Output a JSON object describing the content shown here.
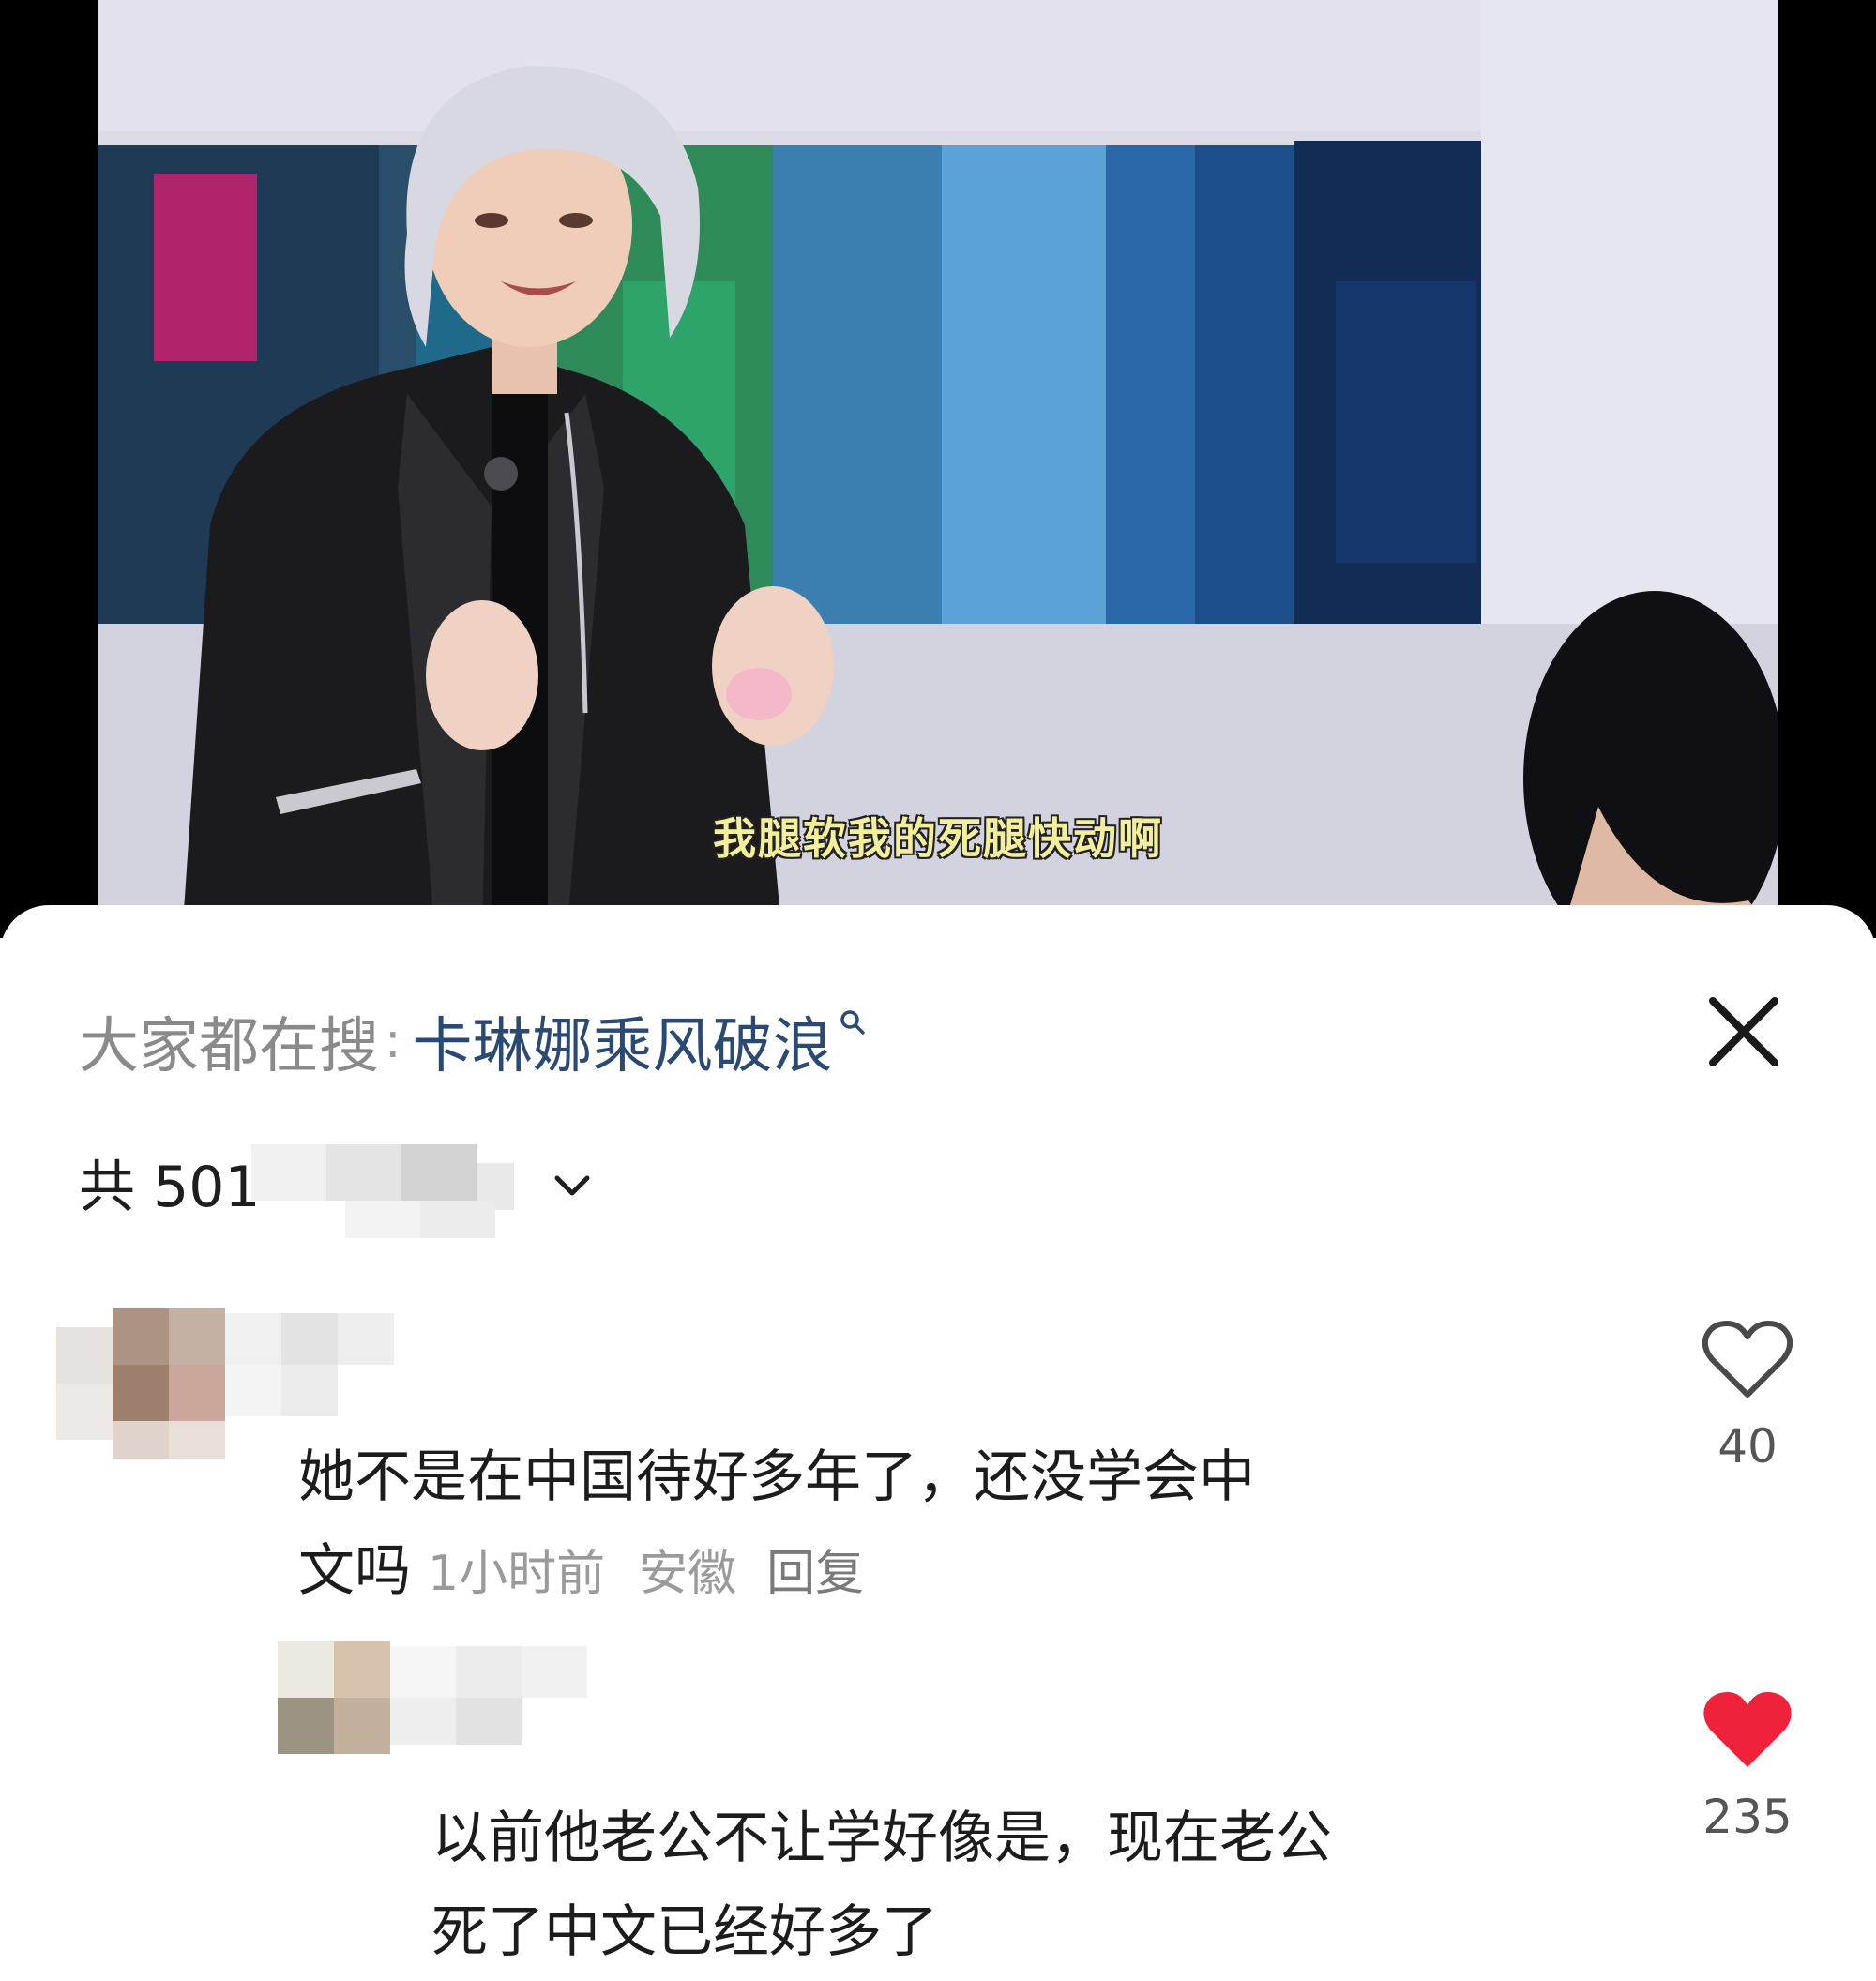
{
  "video": {
    "subtitle": "我腿软我的死腿快动啊"
  },
  "search": {
    "prefix": "大家都在搜",
    "colon": ":",
    "term": "卡琳娜乘风破浪",
    "icon": "search-icon"
  },
  "header": {
    "close_icon": "close-icon",
    "count_text": "共 501",
    "expand_icon": "chevron-down-icon"
  },
  "comments": [
    {
      "line1": "她不是在中国待好多年了，还没学会中",
      "line2": "文吗",
      "time": "1小时前",
      "location": "安徽",
      "reply_label": "回复",
      "likes": "40",
      "liked": false
    },
    {
      "line1": "以前他老公不让学好像是，现在老公",
      "line2": "死了中文已经好多了",
      "likes": "235",
      "liked": true
    }
  ],
  "colors": {
    "link": "#2b4a73",
    "liked_heart": "#f0213a",
    "meta": "#9a9a9a",
    "subtitle": "#f4ef9a"
  }
}
